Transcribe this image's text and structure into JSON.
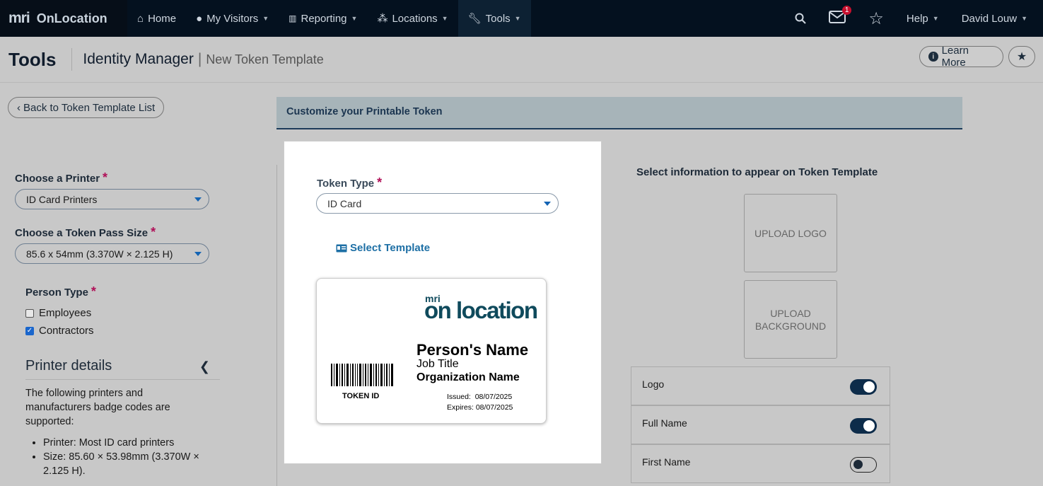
{
  "nav": {
    "brand_mark": "mri",
    "brand_name": "OnLocation",
    "items": [
      "Home",
      "My Visitors",
      "Reporting",
      "Locations",
      "Tools"
    ],
    "mail_count": "1",
    "help": "Help",
    "user": "David Louw"
  },
  "header": {
    "title": "Tools",
    "section": "Identity Manager",
    "sep": "|",
    "page": "New Token Template",
    "learn_more": "Learn More"
  },
  "left": {
    "back": "Back to Token Template List",
    "printer_label": "Choose a Printer",
    "printer_value": "ID Card Printers",
    "size_label": "Choose a Token Pass Size",
    "size_value": "85.6 x 54mm (3.370W × 2.125 H)",
    "person_label": "Person Type",
    "person_types": [
      {
        "label": "Employees",
        "checked": false
      },
      {
        "label": "Contractors",
        "checked": true
      }
    ],
    "details_title": "Printer details",
    "details_text": "The following printers and manufacturers badge codes are supported:",
    "details_items": [
      "Printer: Most ID card printers",
      "Size: 85.60 × 53.98mm (3.370W × 2.125 H)."
    ]
  },
  "banner": "Customize your Printable Token",
  "token": {
    "type_label": "Token Type",
    "type_value": "ID Card",
    "select_template": "Select Template",
    "card": {
      "logo_mark": "mri",
      "logo_text": "on location",
      "name": "Person's Name",
      "job": "Job Title",
      "org": "Organization Name",
      "issued": "Issued:  08/07/2025",
      "expires": "Expires: 08/07/2025",
      "token_id": "TOKEN ID"
    }
  },
  "info": {
    "title": "Select information to appear on Token Template",
    "upload_logo": "UPLOAD LOGO",
    "upload_background_1": "UPLOAD",
    "upload_background_2": "BACKGROUND",
    "toggles": [
      {
        "label": "Logo",
        "on": true
      },
      {
        "label": "Full Name",
        "on": true
      },
      {
        "label": "First Name",
        "on": false
      }
    ]
  },
  "colors": {
    "nav_bg": "#04111f",
    "accent": "#1d6fa5",
    "required": "#b01058",
    "toggle_on": "#0d2c4a"
  }
}
